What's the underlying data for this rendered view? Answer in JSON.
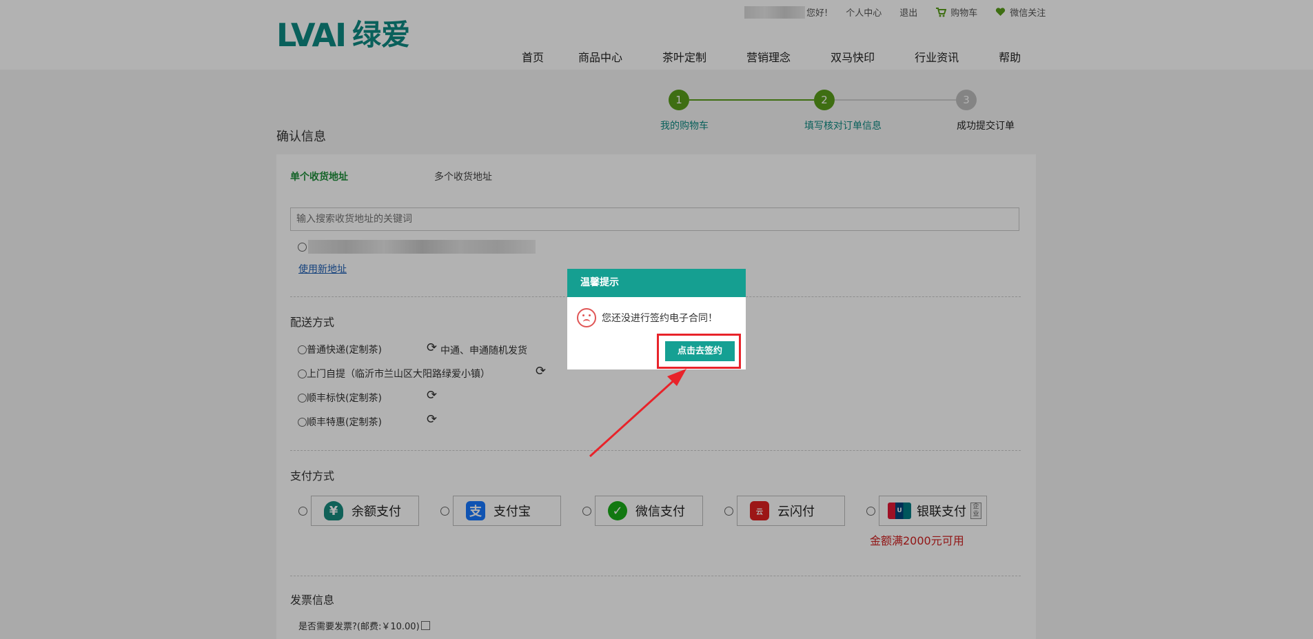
{
  "header": {
    "logo_latin": "LVAI",
    "logo_cjk": "绿爱",
    "greeting": "您好!",
    "top_links": [
      "个人中心",
      "退出",
      "购物车",
      "微信关注"
    ],
    "nav": [
      "首页",
      "商品中心",
      "茶叶定制",
      "营销理念",
      "双马快印",
      "行业资讯",
      "帮助"
    ]
  },
  "steps": [
    {
      "num": "1",
      "label": "我的购物车",
      "state": "done"
    },
    {
      "num": "2",
      "label": "填写核对订单信息",
      "state": "current"
    },
    {
      "num": "3",
      "label": "成功提交订单",
      "state": "todo"
    }
  ],
  "page": {
    "title": "确认信息",
    "address_tabs": [
      "单个收货地址",
      "多个收货地址"
    ],
    "search_placeholder": "输入搜索收货地址的关键词",
    "new_address": "使用新地址",
    "shipping_title": "配送方式",
    "shipping_options": [
      "普通快递(定制茶)",
      "上门自提（临沂市兰山区大阳路绿爱小镇）",
      "顺丰标快(定制茶)",
      "顺丰特惠(定制茶)"
    ],
    "carrier_note": "中通、申通随机发货",
    "payment_title": "支付方式",
    "payment_options": [
      "余额支付",
      "支付宝",
      "微信支付",
      "云闪付",
      "银联支付"
    ],
    "unionpay_tag": "企业",
    "unionpay_note": "金额满2000元可用",
    "invoice_title": "发票信息",
    "invoice_question": "是否需要发票?(邮费:￥10.00)"
  },
  "dialog": {
    "title": "温馨提示",
    "message": "您还没进行签约电子合同！",
    "button": "点击去签约"
  },
  "colors": {
    "brand": "#0e8a83",
    "step_green": "#5a9e1b",
    "dialog_header": "#159f91",
    "highlight": "#e8232a",
    "note_red": "#d02020"
  }
}
